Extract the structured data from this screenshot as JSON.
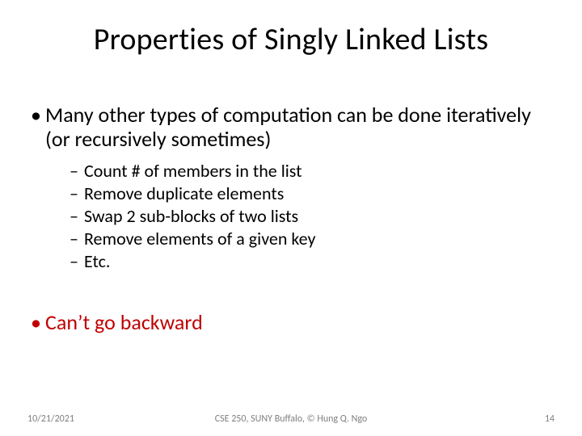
{
  "title": "Properties of Singly Linked Lists",
  "points": {
    "p1": "Many other types of computation can be done iteratively (or recursively sometimes)",
    "sub": [
      "Count # of members in the list",
      "Remove duplicate elements",
      "Swap 2 sub-blocks of two lists",
      "Remove elements of a given key",
      "Etc."
    ],
    "p2": "Can’t go backward"
  },
  "footer": {
    "date": "10/21/2021",
    "center": "CSE 250, SUNY Buffalo, © Hung Q. Ngo",
    "page": "14"
  }
}
